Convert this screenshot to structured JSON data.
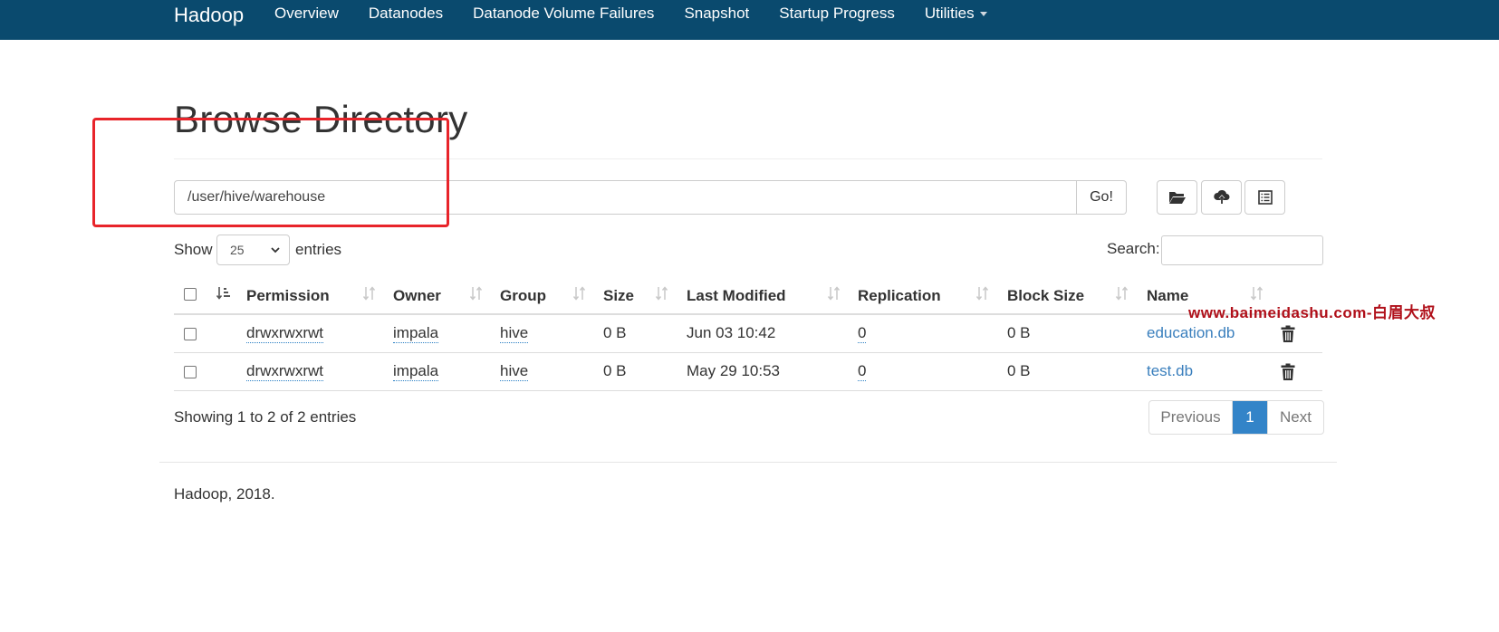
{
  "navbar": {
    "brand": "Hadoop",
    "items": [
      {
        "label": "Overview"
      },
      {
        "label": "Datanodes"
      },
      {
        "label": "Datanode Volume Failures"
      },
      {
        "label": "Snapshot"
      },
      {
        "label": "Startup Progress"
      },
      {
        "label": "Utilities"
      }
    ]
  },
  "page": {
    "title": "Browse Directory"
  },
  "path": {
    "value": "/user/hive/warehouse",
    "go_label": "Go!"
  },
  "toolbar": {
    "icons": [
      "folder-open-icon",
      "upload-cloud-icon",
      "list-icon"
    ]
  },
  "entries": {
    "show_label": "Show",
    "selected": "25",
    "suffix": "entries"
  },
  "search": {
    "label": "Search:",
    "value": ""
  },
  "table": {
    "columns": [
      "Permission",
      "Owner",
      "Group",
      "Size",
      "Last Modified",
      "Replication",
      "Block Size",
      "Name"
    ],
    "rows": [
      {
        "permission": "drwxrwxrwt",
        "owner": "impala",
        "group": "hive",
        "size": "0 B",
        "last_modified": "Jun 03 10:42",
        "replication": "0",
        "block_size": "0 B",
        "name": "education.db"
      },
      {
        "permission": "drwxrwxrwt",
        "owner": "impala",
        "group": "hive",
        "size": "0 B",
        "last_modified": "May 29 10:53",
        "replication": "0",
        "block_size": "0 B",
        "name": "test.db"
      }
    ]
  },
  "info": "Showing 1 to 2 of 2 entries",
  "pagination": {
    "previous": "Previous",
    "current": "1",
    "next": "Next"
  },
  "footer": "Hadoop, 2018.",
  "watermark": "www.baimeidashu.com-白眉大叔",
  "colors": {
    "navbar": "#0a4a6e",
    "link": "#3a7fbd",
    "active_page": "#3384c8",
    "highlight": "#e8242a",
    "watermark": "#b0101a"
  }
}
